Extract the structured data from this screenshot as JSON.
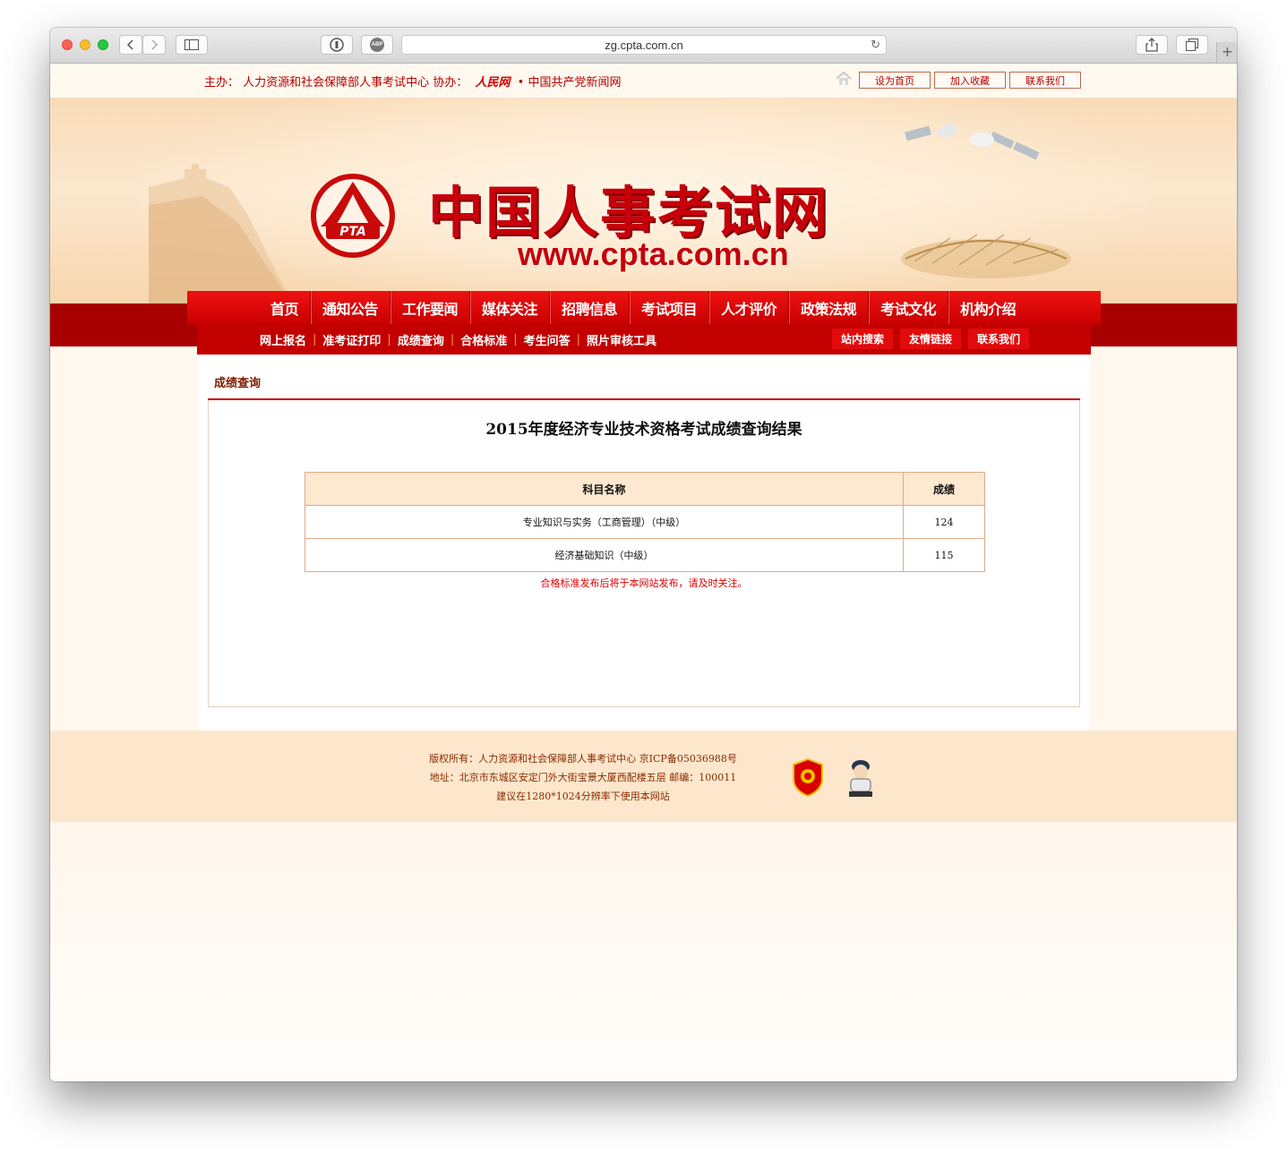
{
  "browser": {
    "url": "zg.cpta.com.cn",
    "reader_icon": "reader-icon",
    "adblock_label": "ABP"
  },
  "topbar": {
    "host_prefix": "主办：",
    "host_org": "人力资源和社会保障部人事考试中心",
    "co_prefix": "协办：",
    "co_logo": "人民网",
    "bullet": "•",
    "co_org": "中国共产党新闻网",
    "links": [
      "设为首页",
      "加入收藏",
      "联系我们"
    ]
  },
  "banner": {
    "logo_text": "PTA",
    "title": "中国人事考试网",
    "url": "www.cpta.com.cn"
  },
  "main_nav": [
    "首页",
    "通知公告",
    "工作要闻",
    "媒体关注",
    "招聘信息",
    "考试项目",
    "人才评价",
    "政策法规",
    "考试文化",
    "机构介绍"
  ],
  "sub_nav": [
    "网上报名",
    "准考证打印",
    "成绩查询",
    "合格标准",
    "考生问答",
    "照片审核工具"
  ],
  "sub_buttons": [
    "站内搜索",
    "友情链接",
    "联系我们"
  ],
  "content": {
    "section_title": "成绩查询",
    "result_title": "2015年度经济专业技术资格考试成绩查询结果",
    "table": {
      "headers": [
        "科目名称",
        "成绩"
      ],
      "rows": [
        {
          "subject": "专业知识与实务（工商管理）（中级）",
          "score": "124"
        },
        {
          "subject": "经济基础知识（中级）",
          "score": "115"
        }
      ]
    },
    "notice": "合格标准发布后将于本网站发布，请及时关注。"
  },
  "footer": {
    "line1": "版权所有：人力资源和社会保障部人事考试中心 京ICP备05036988号",
    "line2": "地址：北京市东城区安定门外大街宝景大厦西配楼五层 邮编：100011",
    "line3": "建议在1280*1024分辨率下使用本网站"
  },
  "colors": {
    "nav_red": "#d90000",
    "dark_red": "#a80000",
    "title_red": "#c8000a",
    "notice_red": "#e00000"
  }
}
